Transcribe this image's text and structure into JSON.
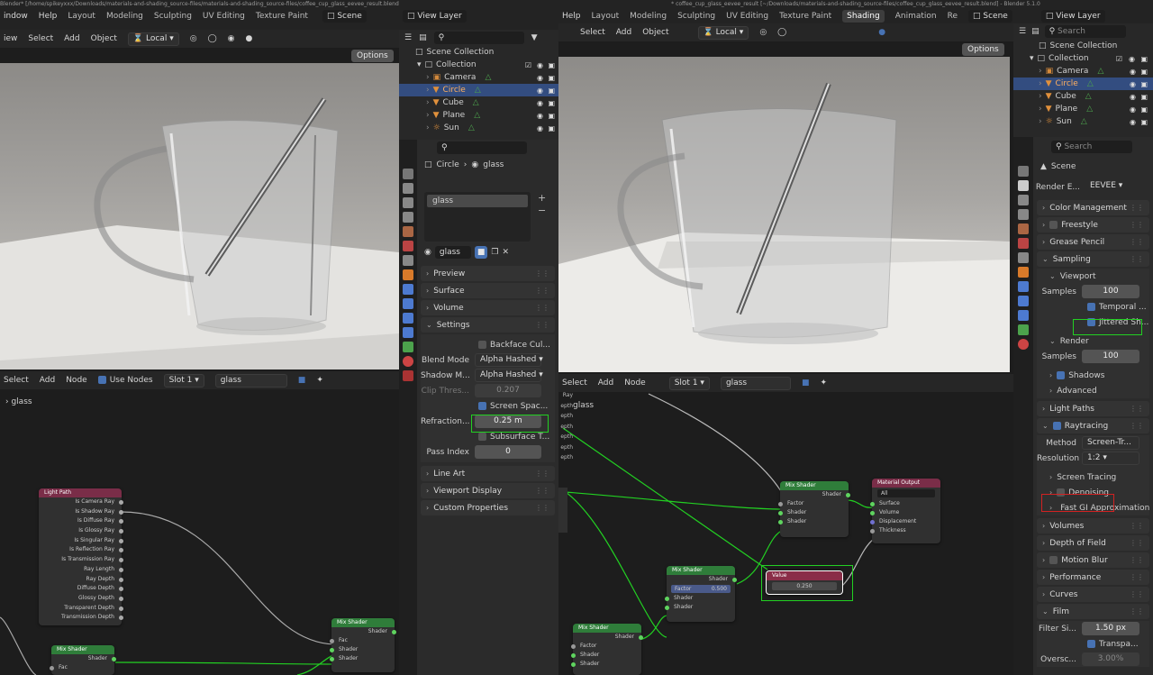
{
  "left": {
    "title": "Blender* [/home/spikeyxxx/Downloads/materials-and-shading_source-files/materials-and-shading_source-files/coffee_cup_glass_eevee_result.blend]",
    "menu": [
      "indow",
      "Help"
    ],
    "tabs": [
      "Layout",
      "Modeling",
      "Sculpting",
      "UV Editing",
      "Texture Paint"
    ],
    "scene": "Scene",
    "view_layer": "View Layer",
    "viewport_menu": [
      "iew",
      "Select",
      "Add",
      "Object"
    ],
    "transform": "Local",
    "options": "Options",
    "node_menu": [
      "Select",
      "Add",
      "Node"
    ],
    "use_nodes": "Use Nodes",
    "slot": "Slot 1",
    "material": "glass",
    "breadcrumb_mat": "glass"
  },
  "outliner_left": {
    "scene_collection": "Scene Collection",
    "collection": "Collection",
    "items": [
      "Camera",
      "Circle",
      "Cube",
      "Plane",
      "Sun"
    ]
  },
  "props_left": {
    "object": "Circle",
    "material": "glass",
    "slot_item": "glass",
    "mat_field": "glass",
    "panels_top": [
      "Preview",
      "Surface",
      "Volume",
      "Settings"
    ],
    "backface": "Backface Cul...",
    "blend_mode_label": "Blend Mode",
    "blend_mode": "Alpha Hashed",
    "shadow_mode_label": "Shadow M...",
    "shadow_mode": "Alpha Hashed",
    "clip_label": "Clip Thres...",
    "clip_value": "0.207",
    "screen_space": "Screen Spac...",
    "refraction_label": "Refraction...",
    "refraction_value": "0.25 m",
    "subsurface": "Subsurface T...",
    "pass_index_label": "Pass Index",
    "pass_index": "0",
    "panels_bottom": [
      "Line Art",
      "Viewport Display",
      "Custom Properties"
    ]
  },
  "light_path": {
    "title": "Light Path",
    "outputs": [
      "Is Camera Ray",
      "Is Shadow Ray",
      "Is Diffuse Ray",
      "Is Glossy Ray",
      "Is Singular Ray",
      "Is Reflection Ray",
      "Is Transmission Ray",
      "Ray Length",
      "Ray Depth",
      "Diffuse Depth",
      "Glossy Depth",
      "Transparent Depth",
      "Transmission Depth"
    ]
  },
  "mix_left_a": {
    "title": "Mix Shader",
    "out": "Shader",
    "inputs": [
      "Fac",
      "Shader",
      "Shader"
    ]
  },
  "mix_left_b": {
    "title": "Mix Shader",
    "out": "Shader",
    "inputs": [
      "Fac"
    ]
  },
  "right": {
    "title": "* coffee_cup_glass_eevee_result [~/Downloads/materials-and-shading_source-files/coffee_cup_glass_eevee_result.blend] - Blender 5.1.0",
    "menu": [
      "Help"
    ],
    "tabs": [
      "Layout",
      "Modeling",
      "Sculpting",
      "UV Editing",
      "Texture Paint",
      "Shading",
      "Animation",
      "Re"
    ],
    "scene": "Scene",
    "view_layer": "View Layer",
    "viewport_menu": [
      "Select",
      "Add",
      "Object"
    ],
    "transform": "Local",
    "options": "Options",
    "node_menu": [
      "Select",
      "Add",
      "Node"
    ],
    "slot": "Slot 1",
    "material": "glass",
    "breadcrumb_mat": "glass",
    "depth_labels": [
      "Ray",
      "epth",
      "epth",
      "epth",
      "epth",
      "epth",
      "epth"
    ]
  },
  "outliner_right": {
    "search": "Search",
    "scene_collection": "Scene Collection",
    "collection": "Collection",
    "items": [
      "Camera",
      "Circle",
      "Cube",
      "Plane",
      "Sun"
    ]
  },
  "props_right": {
    "search": "Search",
    "scene": "Scene",
    "render_engine_label": "Render E...",
    "render_engine": "EEVEE",
    "color_management": "Color Management",
    "freestyle": "Freestyle",
    "grease_pencil": "Grease Pencil",
    "sampling": "Sampling",
    "viewport": "Viewport",
    "samples_label": "Samples",
    "samples": "100",
    "temporal": "Temporal ...",
    "jittered": "Jittered Sh...",
    "render": "Render",
    "render_samples_label": "Samples",
    "render_samples": "100",
    "shadows": "Shadows",
    "advanced": "Advanced",
    "light_paths": "Light Paths",
    "raytracing": "Raytracing",
    "method_label": "Method",
    "method": "Screen-Tr...",
    "resolution_label": "Resolution",
    "resolution": "1:2",
    "screen_tracing": "Screen Tracing",
    "denoising": "Denoising",
    "fast_gi": "Fast GI Approximation",
    "volumes": "Volumes",
    "dof": "Depth of Field",
    "motion_blur": "Motion Blur",
    "performance": "Performance",
    "curves": "Curves",
    "film": "Film",
    "filter_label": "Filter Si...",
    "filter_value": "1.50 px",
    "transparent": "Transpa...",
    "overscan_label": "Oversc...",
    "overscan_value": "3.00%"
  },
  "mix_r1": {
    "title": "Mix Shader",
    "out": "Shader",
    "inputs": [
      "Factor",
      "Shader",
      "Shader"
    ]
  },
  "mix_r2": {
    "title": "Mix Shader",
    "out": "Shader",
    "factor_label": "Factor",
    "factor_value": "0.500",
    "inputs": [
      "Shader",
      "Shader"
    ]
  },
  "mix_r3": {
    "title": "Mix Shader",
    "out": "Shader",
    "inputs": [
      "Factor",
      "Shader",
      "Shader"
    ]
  },
  "mat_output": {
    "title": "Material Output",
    "target": "All",
    "inputs": [
      "Surface",
      "Volume",
      "Displacement",
      "Thickness"
    ]
  },
  "value_node": {
    "title": "Value",
    "value": "0.250"
  }
}
